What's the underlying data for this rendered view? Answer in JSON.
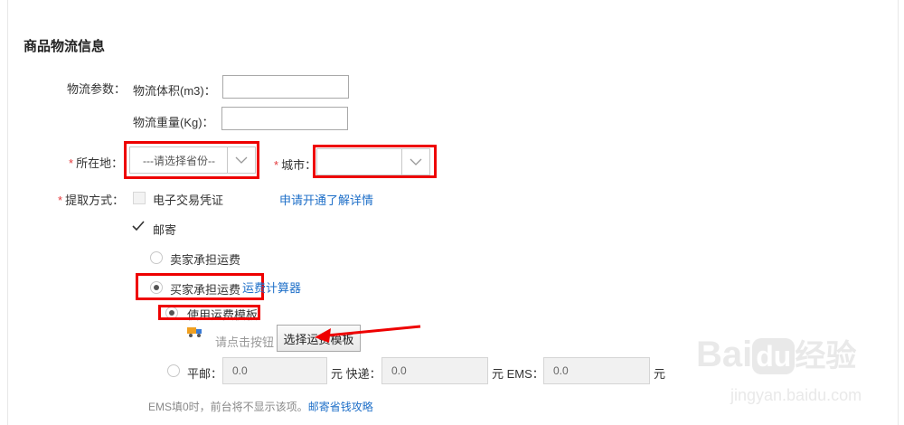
{
  "section_title": "商品物流信息",
  "logistics": {
    "label": "物流参数：",
    "volume_label": "物流体积(m3)：",
    "volume_value": "",
    "weight_label": "物流重量(Kg)：",
    "weight_value": ""
  },
  "location": {
    "required_mark": "*",
    "label": "所在地：",
    "province_placeholder": "---请选择省份--",
    "city_label": "城市：",
    "city_value": ""
  },
  "pickup": {
    "required_mark": "*",
    "label": "提取方式：",
    "ecert_label": "电子交易凭证",
    "apply_link": "申请开通",
    "details_link": "了解详情",
    "mail_label": "邮寄",
    "mail_checked": true,
    "seller_pays_label": "卖家承担运费",
    "buyer_pays_label": "买家承担运费",
    "freight_calc_link": "运费计算器",
    "use_template_label": "使用运费模板",
    "template_hint": "请点击按钮",
    "select_template_button": "选择运费模板",
    "post_label": "平邮：",
    "post_value": "0.0",
    "express_label": "元 快递：",
    "express_value": "0.0",
    "ems_label": "元 EMS：",
    "ems_value": "0.0",
    "yuan_label": "元",
    "ems_note": "EMS填0时，前台将不显示该项。",
    "save_tips_link": "邮寄省钱攻略"
  },
  "watermark": {
    "brand": "Bai",
    "brand_du": "du",
    "brand_cn": "经验",
    "url": "jingyan.baidu.com"
  },
  "colors": {
    "highlight": "#ee0000",
    "link": "#1e6fc8",
    "required": "#e4393c"
  }
}
